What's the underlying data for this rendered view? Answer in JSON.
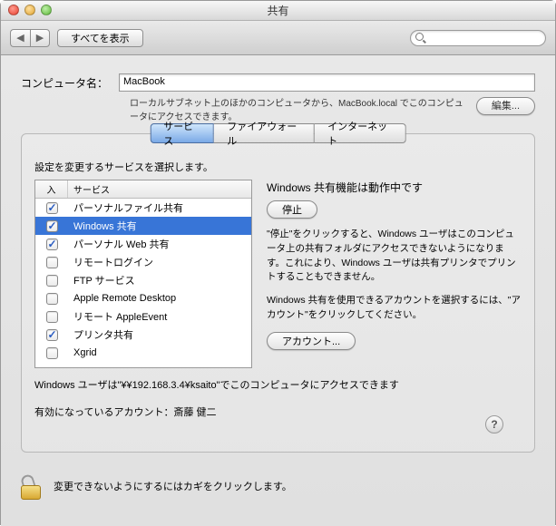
{
  "window": {
    "title": "共有"
  },
  "toolbar": {
    "show_all": "すべてを表示",
    "search_placeholder": ""
  },
  "computer_name": {
    "label": "コンピュータ名：",
    "value": "MacBook",
    "description": "ローカルサブネット上のほかのコンピュータから、MacBook.local でこのコンピュータにアクセスできます。",
    "edit_button": "編集..."
  },
  "tabs": [
    {
      "label": "サービス",
      "active": true
    },
    {
      "label": "ファイアウォール",
      "active": false
    },
    {
      "label": "インターネット",
      "active": false
    }
  ],
  "services_caption": "設定を変更するサービスを選択します。",
  "services_headers": {
    "on": "入",
    "service": "サービス"
  },
  "services": [
    {
      "on": true,
      "name": "パーソナルファイル共有",
      "selected": false
    },
    {
      "on": true,
      "name": "Windows 共有",
      "selected": true
    },
    {
      "on": true,
      "name": "パーソナル Web 共有",
      "selected": false
    },
    {
      "on": false,
      "name": "リモートログイン",
      "selected": false
    },
    {
      "on": false,
      "name": "FTP サービス",
      "selected": false
    },
    {
      "on": false,
      "name": "Apple Remote Desktop",
      "selected": false
    },
    {
      "on": false,
      "name": "リモート AppleEvent",
      "selected": false
    },
    {
      "on": true,
      "name": "プリンタ共有",
      "selected": false
    },
    {
      "on": false,
      "name": "Xgrid",
      "selected": false
    }
  ],
  "service_status": {
    "title": "Windows 共有機能は動作中です",
    "stop_button": "停止",
    "desc1": "\"停止\"をクリックすると、Windows ユーザはこのコンピュータ上の共有フォルダにアクセスできないようになります。これにより、Windows ユーザは共有プリンタでプリントすることもできません。",
    "desc2": "Windows 共有を使用できるアカウントを選択するには、\"アカウント\"をクリックしてください。",
    "account_button": "アカウント..."
  },
  "access_note": "Windows ユーザは\"¥¥192.168.3.4¥ksaito\"でこのコンピュータにアクセスできます",
  "enabled_account": "有効になっているアカウント：斎藤 健二",
  "lock_note": "変更できないようにするにはカギをクリックします。"
}
